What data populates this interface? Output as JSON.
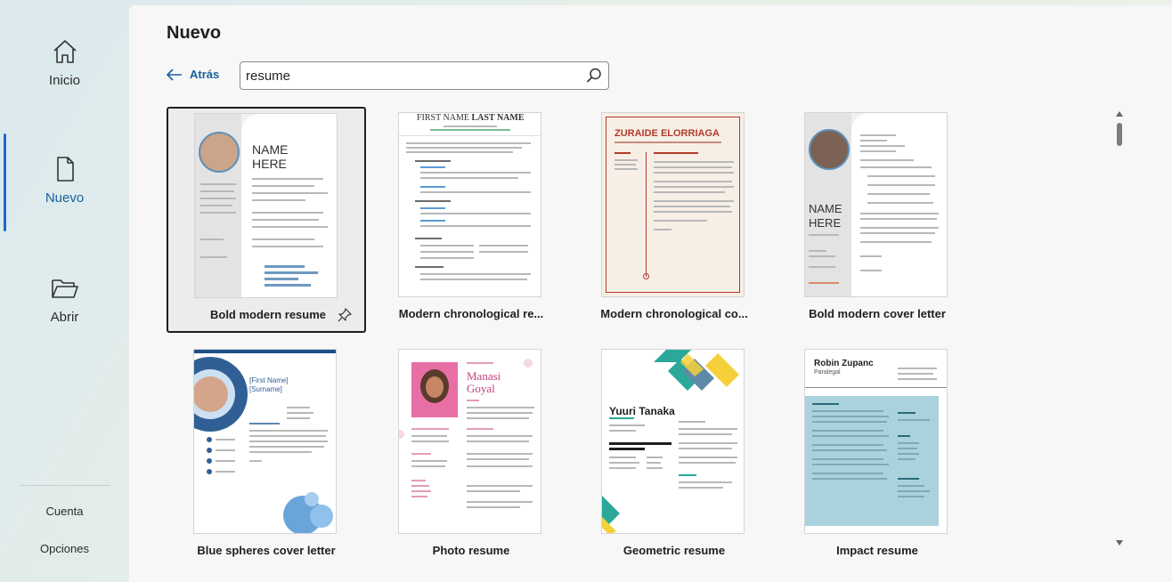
{
  "sidebar": {
    "items": [
      {
        "label": "Inicio",
        "icon": "home-icon"
      },
      {
        "label": "Nuevo",
        "icon": "new-document-icon"
      },
      {
        "label": "Abrir",
        "icon": "folder-open-icon"
      }
    ],
    "bottom": [
      {
        "label": "Cuenta"
      },
      {
        "label": "Opciones"
      }
    ]
  },
  "main": {
    "title": "Nuevo",
    "back_label": "Atrás",
    "search": {
      "value": "resume"
    },
    "templates": [
      {
        "name": "Bold modern resume",
        "thumb_name": "NAME",
        "thumb_name2": "HERE"
      },
      {
        "name": "Modern chronological re...",
        "thumb_first": "FIRST NAME",
        "thumb_last": "LAST NAME"
      },
      {
        "name": "Modern chronological co...",
        "thumb_name": "ZURAIDE ELORRIAGA"
      },
      {
        "name": "Bold modern cover letter",
        "thumb_name": "NAME",
        "thumb_name2": "HERE"
      },
      {
        "name": "Blue spheres cover letter",
        "thumb_name": "[First Name]",
        "thumb_name2": "[Surname]"
      },
      {
        "name": "Photo resume",
        "thumb_name": "Manasi",
        "thumb_name2": "Goyal"
      },
      {
        "name": "Geometric resume",
        "thumb_name": "Yuuri Tanaka"
      },
      {
        "name": "Impact resume",
        "thumb_name": "Robin Zupanc",
        "thumb_sub": "Paralegal"
      }
    ]
  },
  "colors": {
    "accent": "#1b6ac9",
    "link": "#1b5e9e",
    "geo_teal": "#2ba89a",
    "geo_yellow": "#f5d03a",
    "impact_teal": "#a9d2dc",
    "photo_pink": "#c2417c",
    "zuraide_red": "#b23a2a"
  }
}
